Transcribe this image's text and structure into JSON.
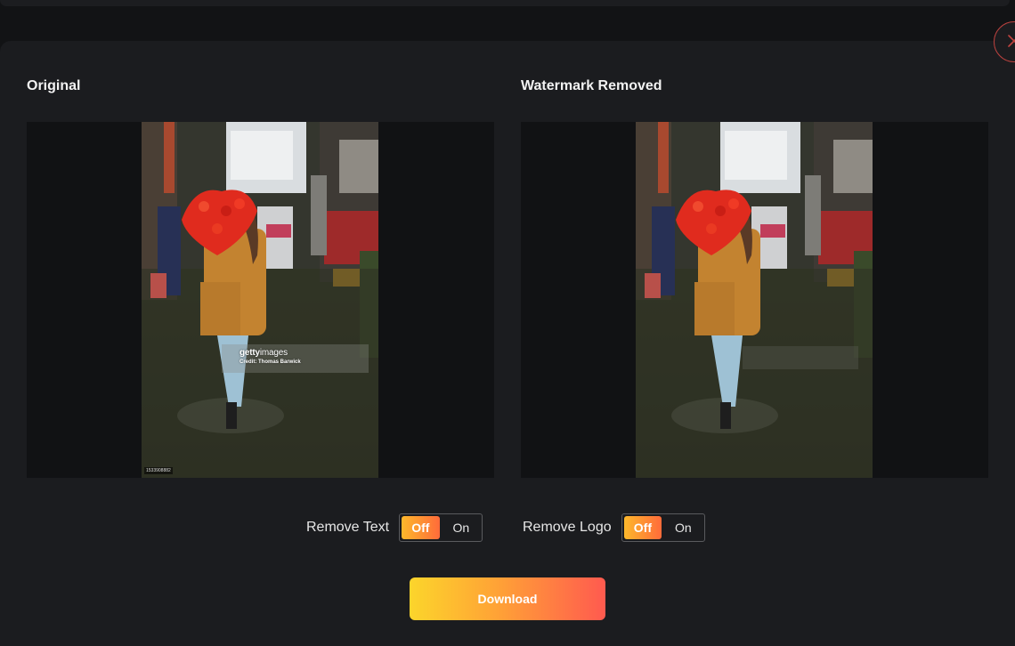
{
  "header": {
    "close_icon": "close-icon"
  },
  "original": {
    "title": "Original",
    "watermark": {
      "brand_bold": "getty",
      "brand_light": "images",
      "credit": "Credit: Thomas Barwick",
      "image_id": "1533908882"
    }
  },
  "processed": {
    "title": "Watermark Removed"
  },
  "controls": {
    "remove_text": {
      "label": "Remove Text",
      "off": "Off",
      "on": "On",
      "selected": "Off"
    },
    "remove_logo": {
      "label": "Remove Logo",
      "off": "Off",
      "on": "On",
      "selected": "Off"
    }
  },
  "download": {
    "label": "Download"
  },
  "colors": {
    "accent_start": "#fcd52b",
    "accent_end": "#ff5a4f",
    "close_ring": "#b8413e",
    "panel_bg": "#1b1c1f"
  }
}
